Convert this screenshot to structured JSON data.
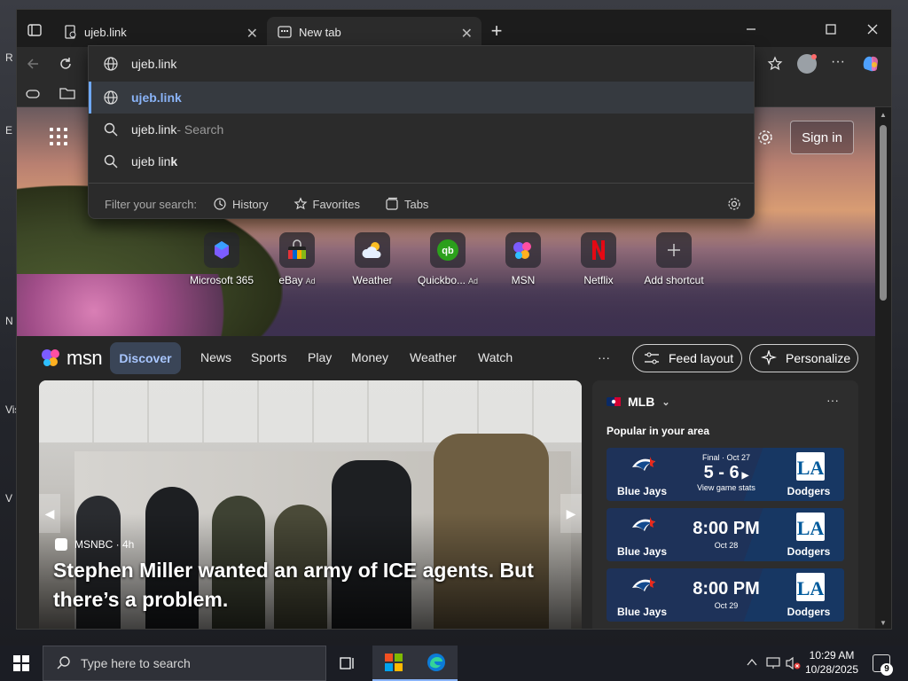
{
  "browser": {
    "tabs": [
      {
        "title": "ujeb.link"
      },
      {
        "title": "New tab"
      }
    ]
  },
  "address_dropdown": {
    "typed": "ujeb.link",
    "suggestions": [
      {
        "text": "ujeb.link",
        "suffix": ""
      },
      {
        "text": "ujeb.link",
        "suffix": " - Search"
      },
      {
        "text": "ujeb lin",
        "bold": "k"
      }
    ],
    "filter_label": "Filter your search:",
    "filters": [
      "History",
      "Favorites",
      "Tabs"
    ]
  },
  "newtab": {
    "signin": "Sign in",
    "shortcuts": [
      {
        "label": "Microsoft 365",
        "ad": ""
      },
      {
        "label": "eBay",
        "ad": "Ad"
      },
      {
        "label": "Weather",
        "ad": ""
      },
      {
        "label": "Quickbo...",
        "ad": "Ad"
      },
      {
        "label": "MSN",
        "ad": ""
      },
      {
        "label": "Netflix",
        "ad": ""
      },
      {
        "label": "Add shortcut",
        "ad": ""
      }
    ]
  },
  "msn": {
    "logo": "msn",
    "nav": [
      "Discover",
      "News",
      "Sports",
      "Play",
      "Money",
      "Weather",
      "Watch"
    ],
    "more": "···",
    "feed_layout": "Feed layout",
    "personalize": "Personalize",
    "story": {
      "source": "MSNBC · 4h",
      "title": "Stephen Miller wanted an army of ICE agents. But there’s a problem."
    },
    "mlb": {
      "title": "MLB",
      "subtitle": "Popular in your area",
      "more": "···",
      "games": [
        {
          "home": "Blue Jays",
          "away": "Dodgers",
          "status": "Final · Oct 27",
          "main": "5 - 6",
          "sub": "View game stats"
        },
        {
          "home": "Blue Jays",
          "away": "Dodgers",
          "status": "",
          "main": "8:00 PM",
          "sub": "Oct 28"
        },
        {
          "home": "Blue Jays",
          "away": "Dodgers",
          "status": "",
          "main": "8:00 PM",
          "sub": "Oct 29"
        }
      ]
    }
  },
  "taskbar": {
    "search_placeholder": "Type here to search",
    "time": "10:29 AM",
    "date": "10/28/2025",
    "notifications": "9"
  },
  "colors": {
    "accent": "#6ea8ff",
    "discover_bg": "#3a4557",
    "bluejays": "#134a8e",
    "dodgers": "#005a9c"
  }
}
